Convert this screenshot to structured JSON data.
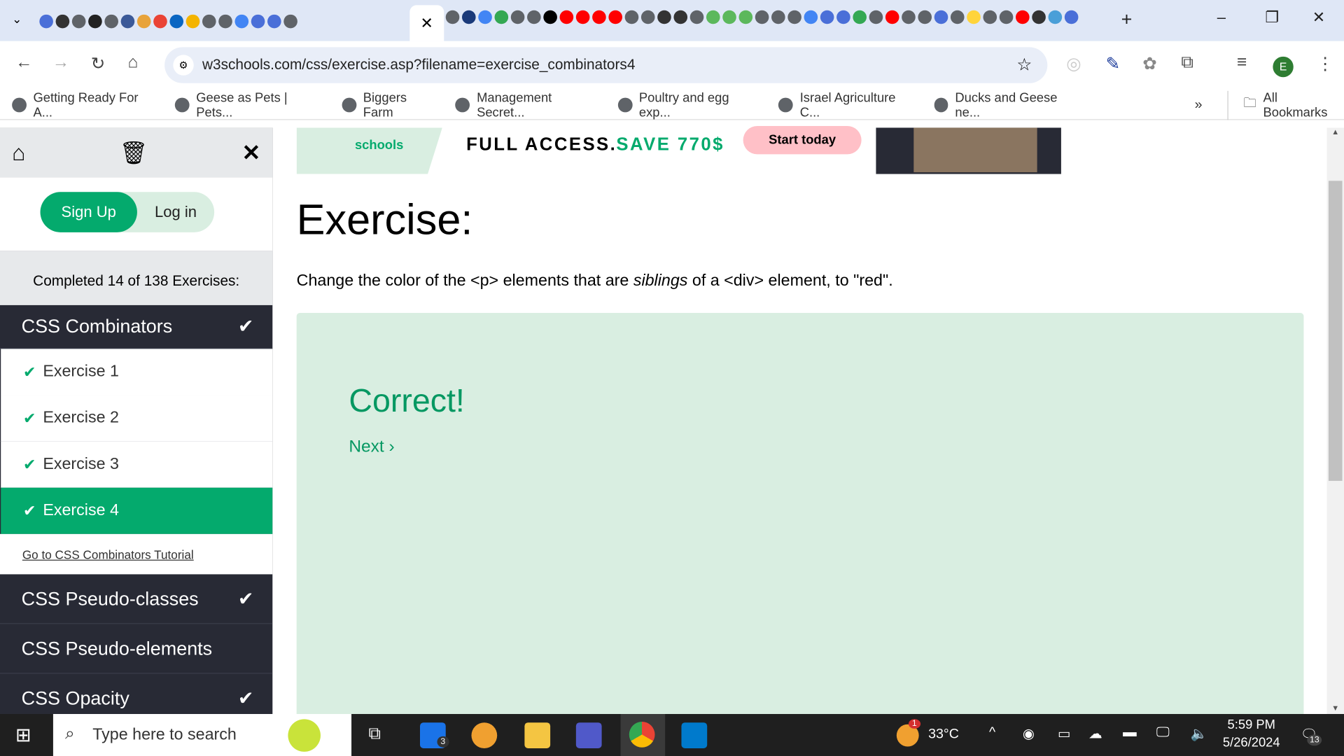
{
  "browser": {
    "url": "w3schools.com/css/exercise.asp?filename=exercise_combinators4",
    "profile_initial": "E",
    "bookmarks": [
      "Getting Ready For A...",
      "Geese as Pets | Pets...",
      "Biggers Farm",
      "Management Secret...",
      "Poultry and egg exp...",
      "Israel Agriculture C...",
      "Ducks and Geese ne..."
    ],
    "all_bookmarks": "All Bookmarks"
  },
  "banner": {
    "logo": "schools",
    "headline": "FULL ACCESS.",
    "offer": "SAVE 770$",
    "cta": "Start today"
  },
  "sidebar": {
    "signup": "Sign Up",
    "login": "Log in",
    "completed": "Completed 14 of 138 Exercises:",
    "current_category": "CSS Combinators",
    "exercises": [
      "Exercise 1",
      "Exercise 2",
      "Exercise 3",
      "Exercise 4"
    ],
    "tutorial_link": "Go to CSS Combinators Tutorial",
    "categories": [
      "CSS Pseudo-classes",
      "CSS Pseudo-elements",
      "CSS Opacity"
    ]
  },
  "main": {
    "title": "Exercise:",
    "instr_a": "Change the color of the <p> elements that are ",
    "instr_em": "siblings",
    "instr_b": " of a <div> element, to \"red\".",
    "result": "Correct!",
    "next": "Next"
  },
  "taskbar": {
    "search_placeholder": "Type here to search",
    "mail_badge": "3",
    "temp": "33°C",
    "weather_badge": "1",
    "time": "5:59 PM",
    "date": "5/26/2024",
    "notifications": "13"
  }
}
